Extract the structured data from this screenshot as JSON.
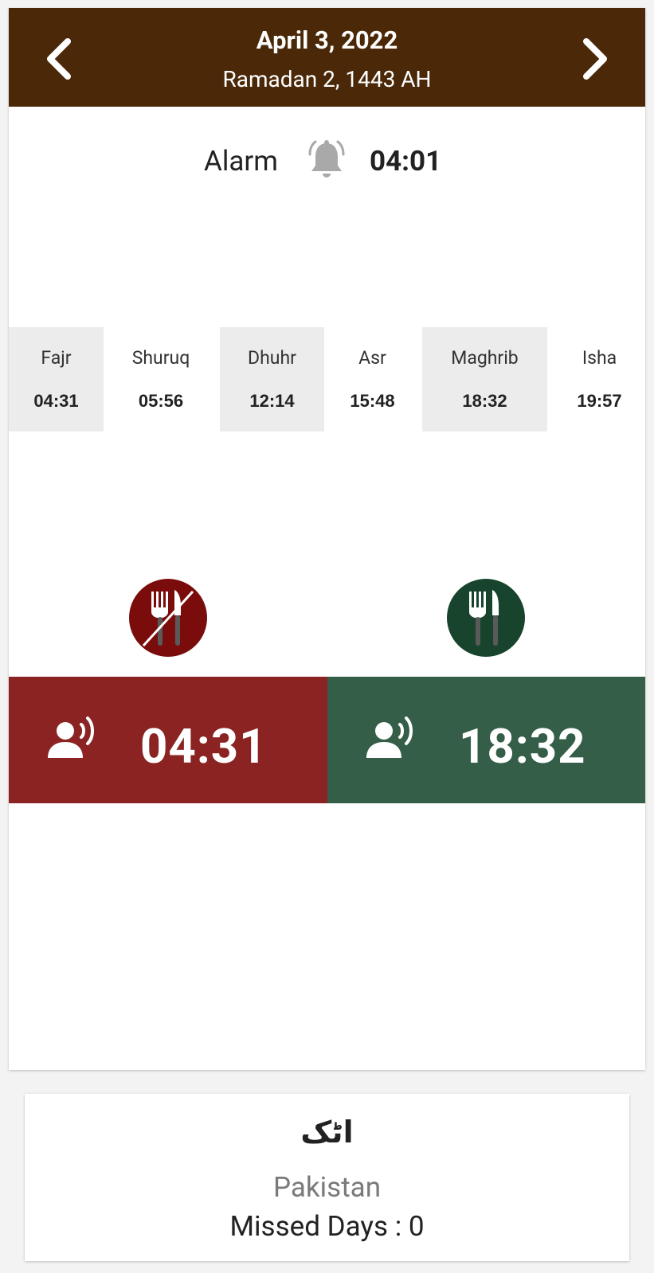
{
  "header": {
    "date": "April 3, 2022",
    "hijri_date": "Ramadan 2, 1443 AH",
    "prev_icon": "chevron-left-icon",
    "next_icon": "chevron-right-icon",
    "background_color": "#4a2808"
  },
  "alarm": {
    "label": "Alarm",
    "icon": "bell-ringing-icon",
    "time": "04:01"
  },
  "prayers": [
    {
      "name": "Fajr",
      "time": "04:31"
    },
    {
      "name": "Shuruq",
      "time": "05:56"
    },
    {
      "name": "Dhuhr",
      "time": "12:14"
    },
    {
      "name": "Asr",
      "time": "15:48"
    },
    {
      "name": "Maghrib",
      "time": "18:32"
    },
    {
      "name": "Isha",
      "time": "19:57"
    }
  ],
  "fasting": {
    "sehri": {
      "icon": "no-eating-icon",
      "speaker_icon": "adhan-speaker-icon",
      "time": "04:31",
      "color": "#8b2323"
    },
    "iftar": {
      "icon": "eating-icon",
      "speaker_icon": "adhan-speaker-icon",
      "time": "18:32",
      "color": "#345e48"
    }
  },
  "location": {
    "city": "اٹک",
    "country": "Pakistan",
    "missed_days": "Missed Days : 0"
  }
}
